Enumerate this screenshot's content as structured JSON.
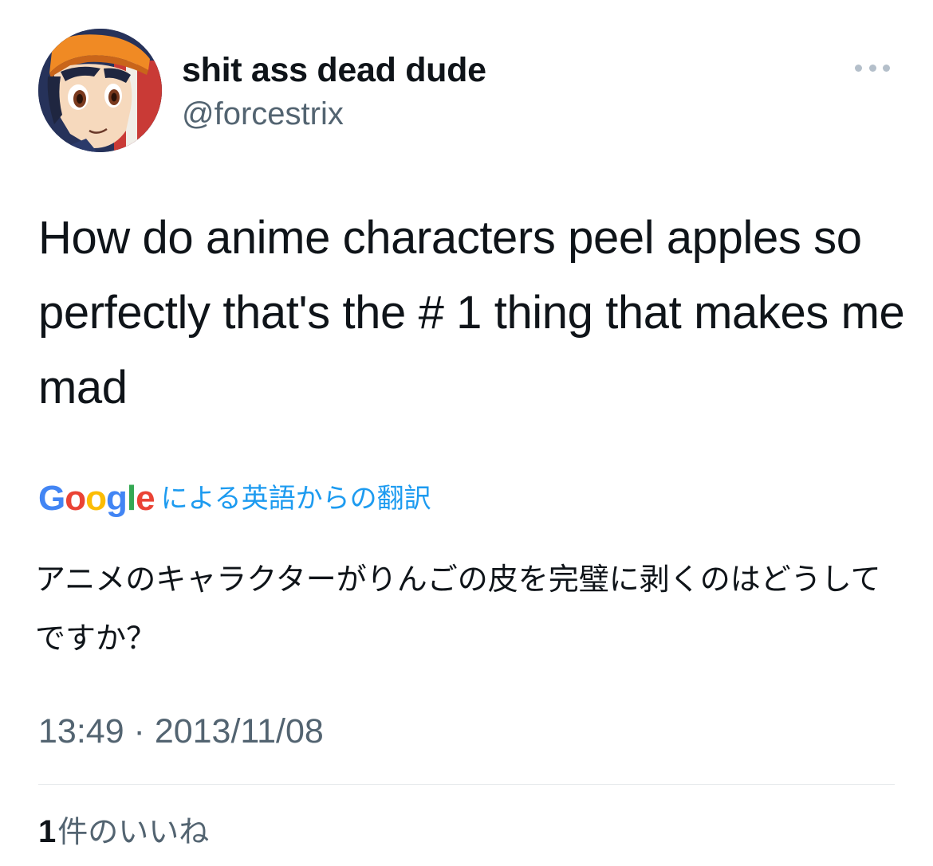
{
  "author": {
    "display_name": "shit ass dead dude",
    "handle": "@forcestrix",
    "avatar_icon": "anime-character-avatar"
  },
  "more_icon": "ellipsis-icon",
  "tweet": {
    "text": "How do anime characters peel apples so perfectly that's the # 1 thing that makes me mad"
  },
  "translation": {
    "provider_logo_letters": [
      "G",
      "o",
      "o",
      "g",
      "l",
      "e"
    ],
    "label_suffix": "による英語からの翻訳",
    "text": "アニメのキャラクターがりんごの皮を完璧に剥くのはどうしてですか？"
  },
  "meta": {
    "timestamp": "13:49 · 2013/11/08"
  },
  "stats": {
    "likes_count": "1",
    "likes_label": "件のいいね"
  },
  "colors": {
    "text_primary": "#0f1419",
    "text_secondary": "#536471",
    "link_blue": "#1d9bf0",
    "google_blue": "#4285f4",
    "google_red": "#ea4335",
    "google_yellow": "#fbbc05",
    "google_green": "#34a853"
  }
}
